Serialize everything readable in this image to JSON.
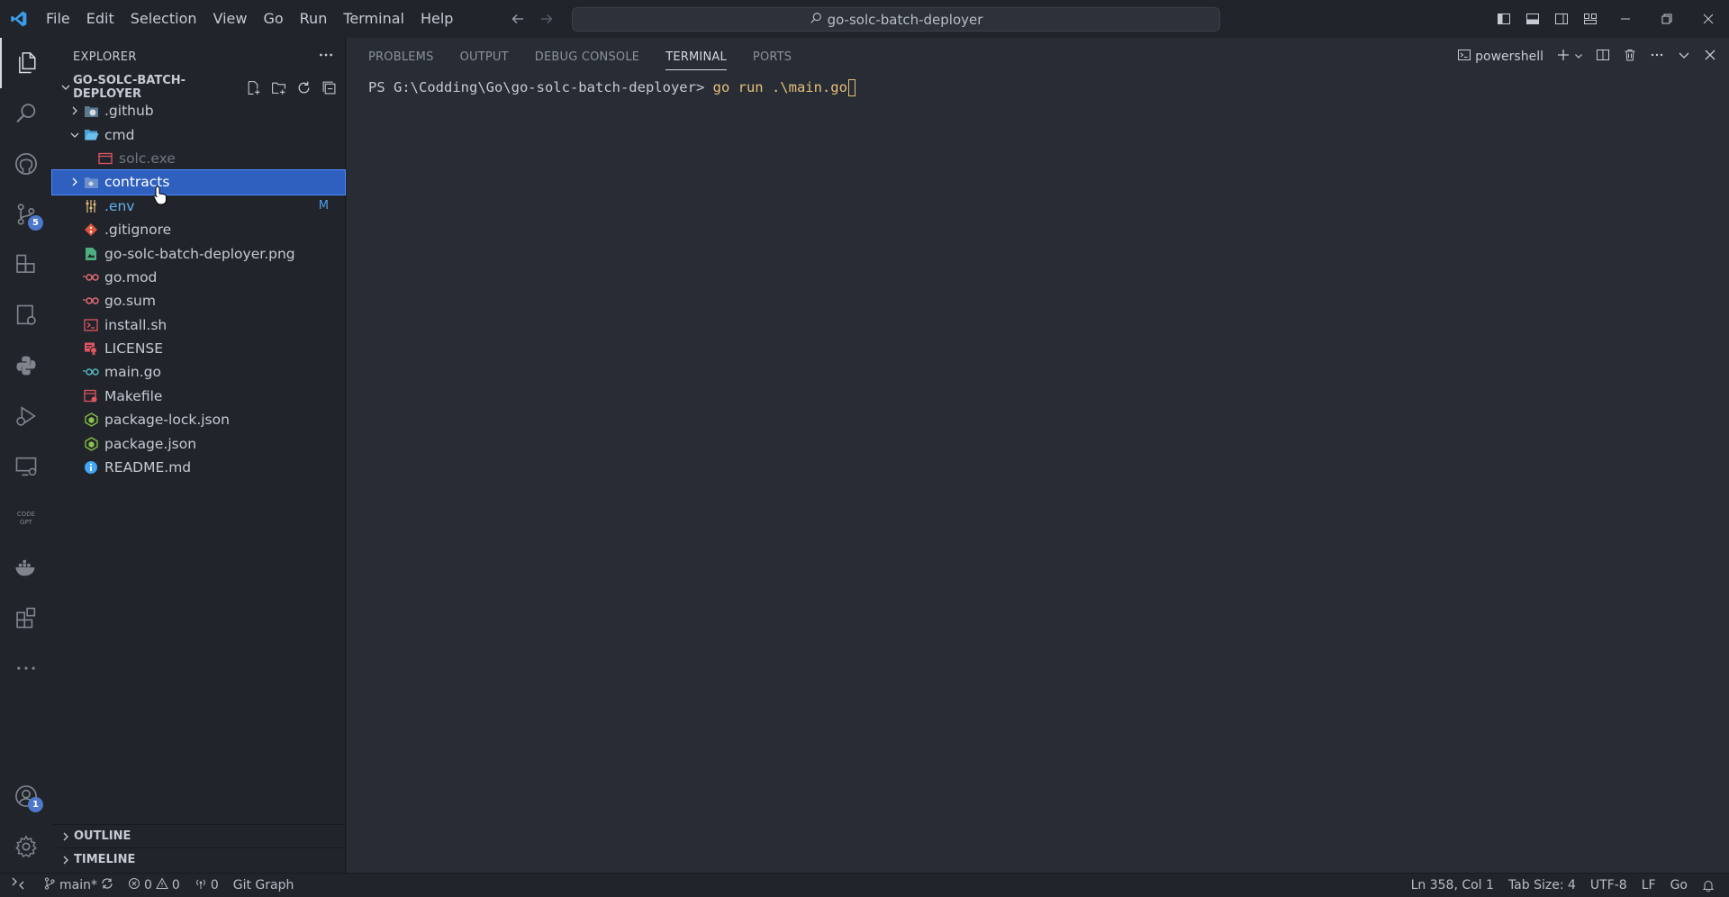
{
  "menu": [
    "File",
    "Edit",
    "Selection",
    "View",
    "Go",
    "Run",
    "Terminal",
    "Help"
  ],
  "command_center": {
    "label": "go-solc-batch-deployer"
  },
  "activity": {
    "source_control_badge": "5",
    "accounts_badge": "1"
  },
  "explorer": {
    "title": "EXPLORER",
    "folder": "GO-SOLC-BATCH-DEPLOYER",
    "items": [
      {
        "label": ".github"
      },
      {
        "label": "cmd"
      },
      {
        "label": "solc.exe"
      },
      {
        "label": "contracts"
      },
      {
        "label": ".env",
        "status": "M"
      },
      {
        "label": ".gitignore"
      },
      {
        "label": "go-solc-batch-deployer.png"
      },
      {
        "label": "go.mod"
      },
      {
        "label": "go.sum"
      },
      {
        "label": "install.sh"
      },
      {
        "label": "LICENSE"
      },
      {
        "label": "main.go"
      },
      {
        "label": "Makefile"
      },
      {
        "label": "package-lock.json"
      },
      {
        "label": "package.json"
      },
      {
        "label": "README.md"
      }
    ],
    "outline": "OUTLINE",
    "timeline": "TIMELINE"
  },
  "panel": {
    "tabs": [
      "PROBLEMS",
      "OUTPUT",
      "DEBUG CONSOLE",
      "TERMINAL",
      "PORTS"
    ],
    "shell": "powershell",
    "prompt": "PS G:\\Codding\\Go\\go-solc-batch-deployer>",
    "command": "go run .\\main.go"
  },
  "status": {
    "branch": "main*",
    "errors": "0",
    "warnings": "0",
    "ports": "0",
    "git_graph": "Git Graph",
    "position": "Ln 358, Col 1",
    "tab_size": "Tab Size: 4",
    "encoding": "UTF-8",
    "eol": "LF",
    "language": "Go"
  }
}
